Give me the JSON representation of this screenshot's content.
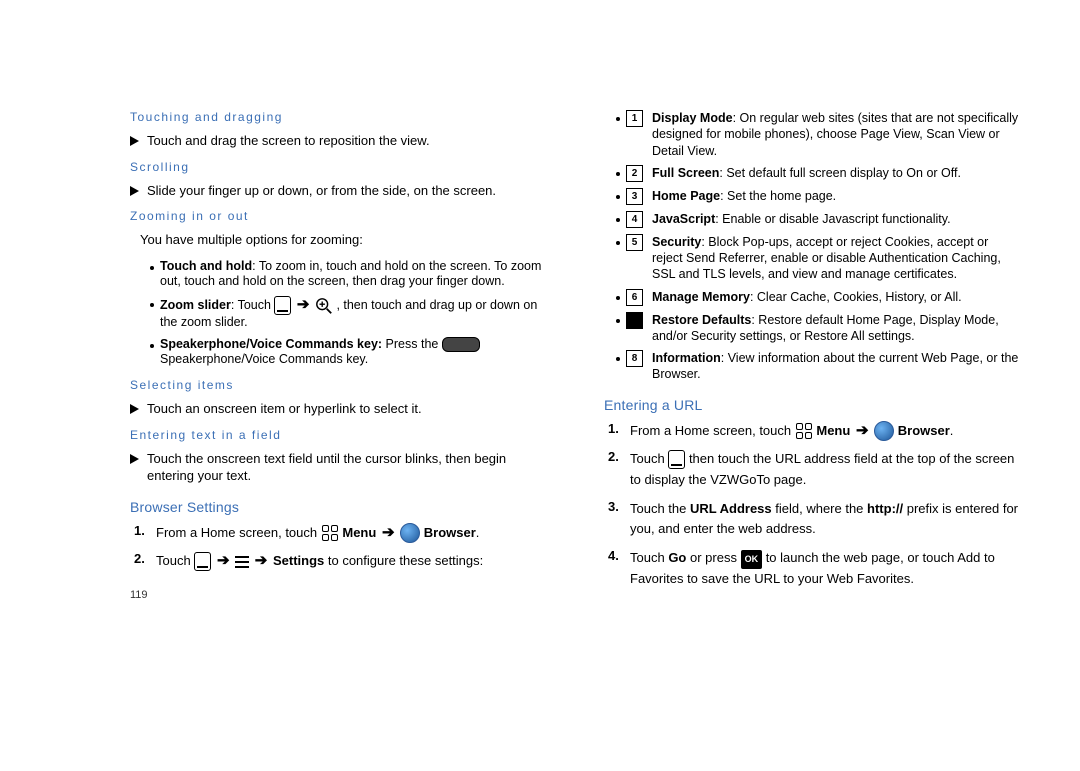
{
  "left": {
    "h1": "Touching and dragging",
    "p1": "Touch and drag the screen to reposition the view.",
    "h2": "Scrolling",
    "p2": "Slide your finger up or down, or from the side, on the screen.",
    "h3": "Zooming in or out",
    "p3": "You have multiple options for zooming:",
    "z1b": "Touch and hold",
    "z1t": ": To zoom in, touch and hold on the screen. To zoom out, touch and hold on the screen, then drag your finger down.",
    "z2b": "Zoom slider",
    "z2t1": ": Touch ",
    "z2t2": " , then touch and drag up or down on the zoom slider.",
    "z3b": "Speakerphone/Voice Commands key:",
    "z3t1": "  Press the ",
    "z3t2": "Speakerphone/Voice Commands key.",
    "h4": "Selecting items",
    "p4": "Touch an onscreen item or hyperlink to select it.",
    "h5": "Entering text in a field",
    "p5": "Touch the onscreen text field until the cursor blinks, then begin entering your text.",
    "h6": "Browser Settings",
    "bs1a": "From a Home screen, touch ",
    "bs1b": "Menu",
    "bs1c": "Browser",
    "bs2a": "Touch ",
    "bs2b": "Settings",
    "bs2c": " to configure these settings:",
    "page": "119"
  },
  "right": {
    "s1b": "Display Mode",
    "s1t": ": On regular web sites (sites that are not specifically designed for mobile phones), choose Page View, Scan View or Detail View.",
    "s2b": "Full Screen",
    "s2t": ": Set default full screen display to On or Off.",
    "s3b": "Home Page",
    "s3t": ": Set the home page.",
    "s4b": "JavaScript",
    "s4t": ": Enable or disable Javascript functionality.",
    "s5b": "Security",
    "s5t": ": Block Pop-ups, accept or reject Cookies, accept or reject Send Referrer, enable or disable Authentication Caching, SSL and TLS levels, and view and manage certificates.",
    "s6b": "Manage Memory",
    "s6t": ": Clear Cache, Cookies, History, or All.",
    "s7b": "Restore Defaults",
    "s7t": ": Restore default Home Page, Display Mode, and/or Security settings, or Restore All settings.",
    "s8b": "Information",
    "s8t": ": View information about the current Web Page, or the Browser.",
    "h1": "Entering a URL",
    "u1a": "From a Home screen, touch ",
    "u1b": "Menu",
    "u1c": "Browser",
    "u2a": "Touch ",
    "u2b": " then touch the URL address field at the top of the screen to display the VZWGoTo page.",
    "u3a": "Touch the ",
    "u3b": "URL Address",
    "u3c": " field, where the ",
    "u3d": "http://",
    "u3e": " prefix is entered for you, and enter the web address.",
    "u4a": "Touch ",
    "u4b": "Go",
    "u4c": " or press ",
    "u4d": " to launch the web page, or touch Add to Favorites to save the URL to your Web Favorites."
  }
}
